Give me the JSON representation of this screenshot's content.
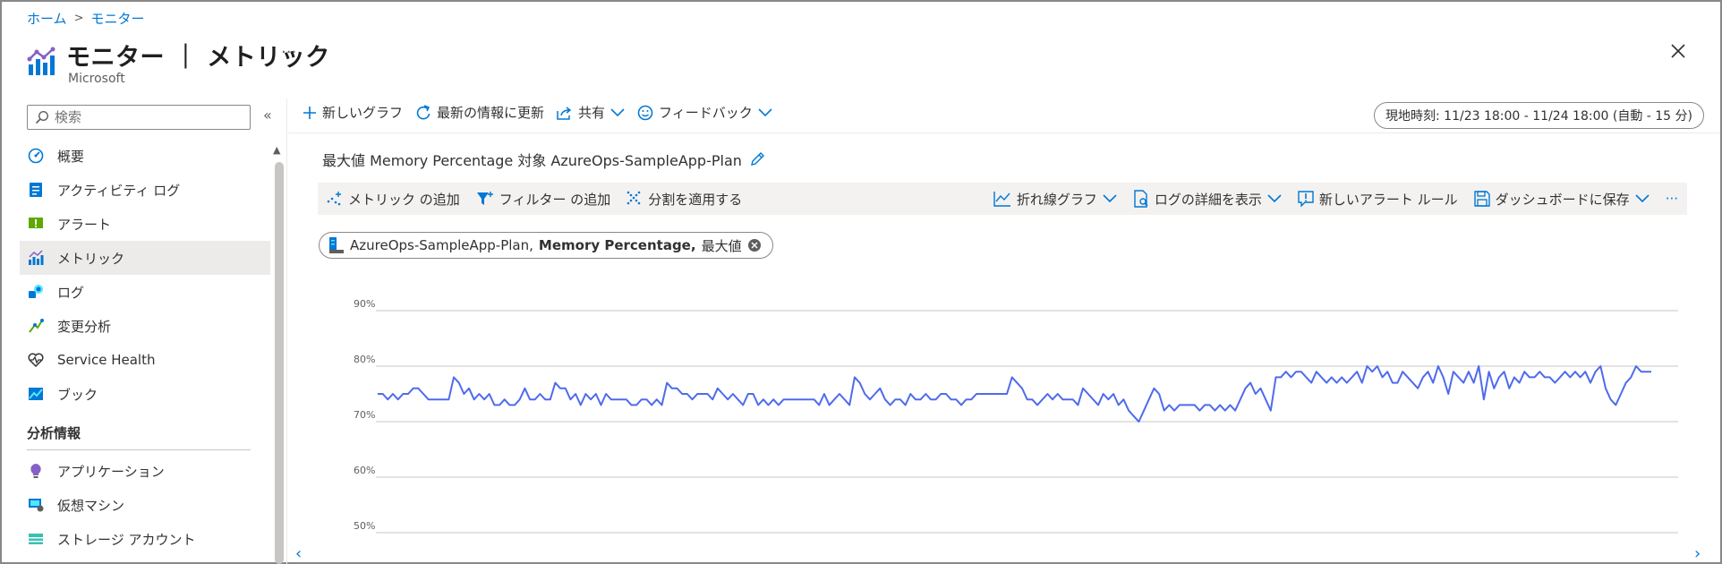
{
  "breadcrumb": {
    "home": "ホーム",
    "current": "モニター"
  },
  "header": {
    "title": "モニター ｜ メトリック",
    "subtitle": "Microsoft",
    "more": "···"
  },
  "search": {
    "placeholder": "検索"
  },
  "sidebar": {
    "collapse": "«",
    "items": [
      {
        "label": "概要",
        "icon": "overview-icon"
      },
      {
        "label": "アクティビティ ログ",
        "icon": "activity-log-icon"
      },
      {
        "label": "アラート",
        "icon": "alert-icon"
      },
      {
        "label": "メトリック",
        "icon": "metrics-icon",
        "active": true
      },
      {
        "label": "ログ",
        "icon": "logs-icon"
      },
      {
        "label": "変更分析",
        "icon": "change-analysis-icon"
      },
      {
        "label": "Service Health",
        "icon": "service-health-icon"
      },
      {
        "label": "ブック",
        "icon": "workbooks-icon"
      }
    ],
    "section": "分析情報",
    "section_items": [
      {
        "label": "アプリケーション",
        "icon": "application-icon"
      },
      {
        "label": "仮想マシン",
        "icon": "vm-icon"
      },
      {
        "label": "ストレージ アカウント",
        "icon": "storage-icon"
      }
    ]
  },
  "toolbar": {
    "new_chart": "新しいグラフ",
    "refresh": "最新の情報に更新",
    "share": "共有",
    "feedback": "フィードバック",
    "time_range": "現地時刻: 11/23 18:00 - 11/24 18:00 (自動 - 15 分)"
  },
  "chart_header": {
    "title": "最大値 Memory Percentage 対象 AzureOps-SampleApp-Plan"
  },
  "chart_toolbar": {
    "add_metric": "メトリック の追加",
    "add_filter": "フィルター の追加",
    "apply_split": "分割を適用する",
    "line_chart": "折れ線グラフ",
    "view_logs": "ログの詳細を表示",
    "new_alert": "新しいアラート ルール",
    "save_dashboard": "ダッシュボードに保存",
    "more": "···"
  },
  "metric_pill": {
    "resource": "AzureOps-SampleApp-Plan,",
    "metric": "Memory Percentage,",
    "aggregation": "最大値"
  },
  "colors": {
    "accent": "#0078d4",
    "series": "#4f6bed"
  },
  "chart_data": {
    "type": "line",
    "ylim": [
      50,
      90
    ],
    "yticks": [
      "90%",
      "80%",
      "70%",
      "60%",
      "50%"
    ],
    "series": [
      {
        "values": [
          75,
          75,
          74,
          75,
          74,
          75,
          75,
          76,
          76,
          75,
          74,
          74,
          74,
          74,
          74,
          78,
          77,
          75,
          76,
          74,
          75,
          74,
          75,
          73,
          73,
          74,
          73,
          73,
          74,
          76,
          74,
          74,
          75,
          74,
          74,
          77,
          76,
          76,
          74,
          75,
          73,
          75,
          74,
          75,
          73,
          75,
          74,
          74,
          74,
          74,
          73,
          73,
          74,
          74,
          73,
          74,
          73,
          77,
          76,
          76,
          75,
          75,
          74,
          75,
          75,
          75,
          74,
          76,
          75,
          74,
          75,
          74,
          73,
          75,
          75,
          73,
          74,
          73,
          74,
          73,
          74,
          74,
          74,
          74,
          74,
          74,
          74,
          73,
          75,
          73,
          74,
          75,
          74,
          73,
          78,
          77,
          75,
          74,
          75,
          76,
          74,
          73,
          74,
          74,
          73,
          75,
          74,
          74,
          75,
          74,
          74,
          75,
          75,
          74,
          74,
          73,
          74,
          74,
          75,
          75,
          75,
          75,
          75,
          75,
          75,
          78,
          77,
          76,
          74,
          74,
          73,
          74,
          75,
          74,
          75,
          74,
          74,
          74,
          73,
          76,
          75,
          74,
          73,
          75,
          74,
          75,
          73,
          74,
          72,
          71,
          70,
          72,
          74,
          76,
          75,
          72,
          73,
          72,
          73,
          73,
          73,
          73,
          72,
          73,
          73,
          72,
          73,
          72,
          73,
          72,
          74,
          76,
          77,
          75,
          76,
          74,
          72,
          78,
          78,
          79,
          78,
          79,
          79,
          78,
          77,
          79,
          78,
          77,
          78,
          77,
          78,
          77,
          78,
          79,
          77,
          80,
          79,
          80,
          78,
          79,
          77,
          77,
          79,
          78,
          77,
          76,
          78,
          79,
          77,
          80,
          78,
          75,
          79,
          78,
          77,
          79,
          77,
          80,
          74,
          79,
          76,
          78,
          79,
          76,
          78,
          77,
          79,
          78,
          78,
          79,
          78,
          78,
          77,
          78,
          79,
          78,
          79,
          78,
          79,
          77,
          79,
          80,
          76,
          74,
          73,
          75,
          77,
          78,
          80,
          79,
          79,
          79
        ]
      }
    ]
  }
}
